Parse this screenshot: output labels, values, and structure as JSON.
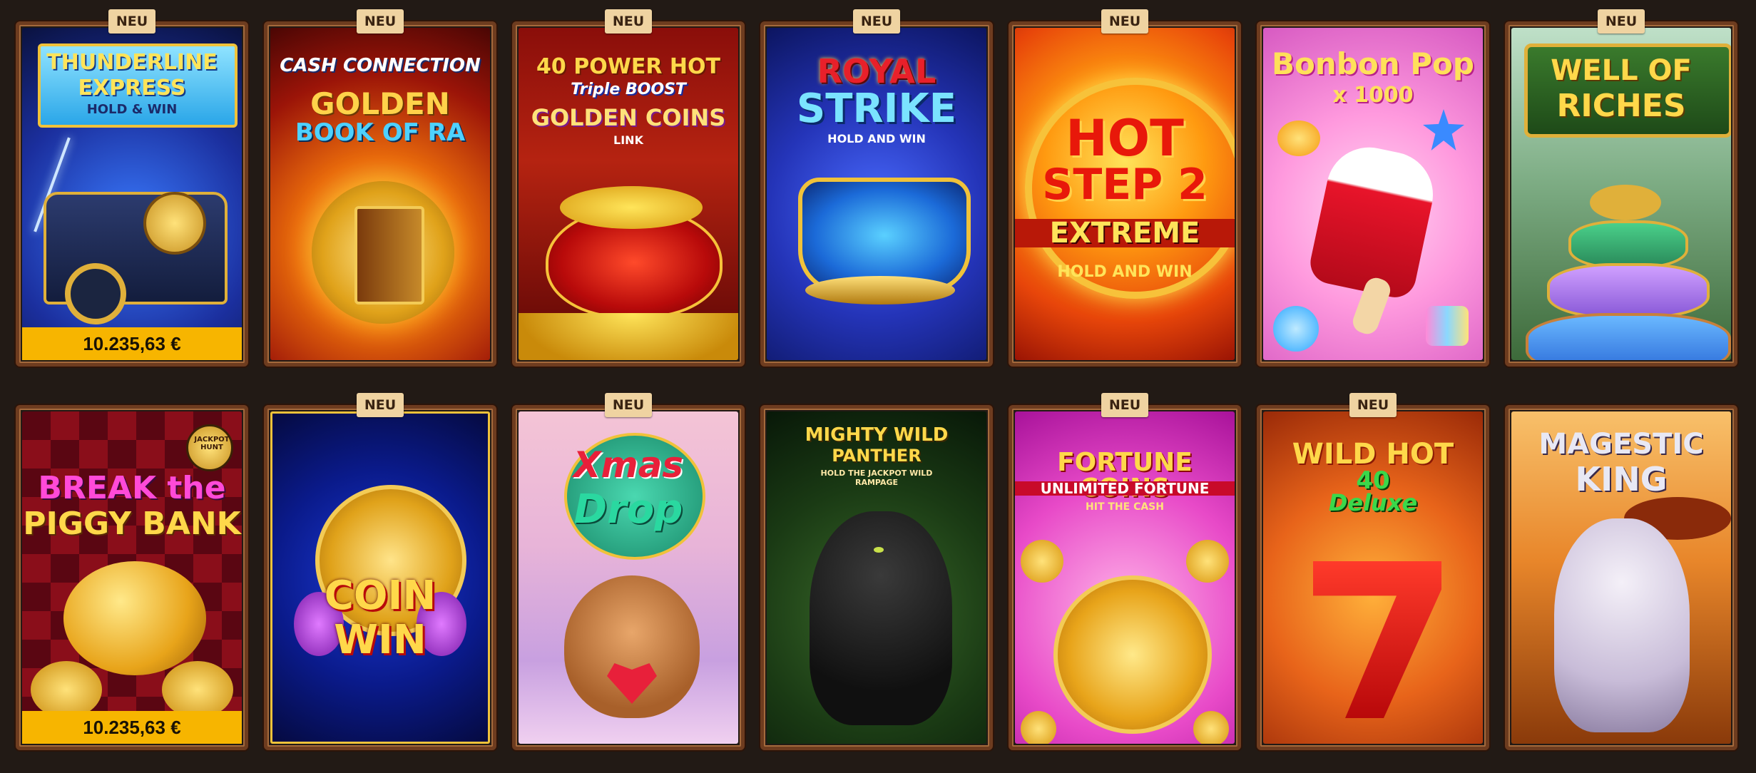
{
  "badge_text": "NEU",
  "games": [
    {
      "title_lines": [
        "THUNDERLINE",
        "EXPRESS"
      ],
      "subtitle": "HOLD & WIN",
      "is_new": true,
      "jackpot": "10.235,63 €"
    },
    {
      "title_lines": [
        "CASH CONNECTION",
        "GOLDEN",
        "BOOK OF RA"
      ],
      "subtitle": "",
      "is_new": true,
      "jackpot": ""
    },
    {
      "title_lines": [
        "40 POWER HOT",
        "Triple BOOST",
        "GOLDEN COINS"
      ],
      "subtitle": "LINK",
      "is_new": true,
      "jackpot": ""
    },
    {
      "title_lines": [
        "ROYAL",
        "STRIKE"
      ],
      "subtitle": "HOLD AND WIN",
      "is_new": true,
      "jackpot": ""
    },
    {
      "title_lines": [
        "HOT",
        "STEP 2",
        "EXTREME"
      ],
      "subtitle": "HOLD AND WIN",
      "is_new": true,
      "jackpot": ""
    },
    {
      "title_lines": [
        "Bonbon Pop",
        "x 1000"
      ],
      "subtitle": "",
      "is_new": false,
      "jackpot": ""
    },
    {
      "title_lines": [
        "WELL OF",
        "RICHES"
      ],
      "subtitle": "",
      "is_new": true,
      "jackpot": ""
    },
    {
      "title_lines": [
        "BREAK the",
        "PIGGY BANK"
      ],
      "subtitle": "JACKPOT HUNT",
      "is_new": false,
      "jackpot": "10.235,63 €"
    },
    {
      "title_lines": [
        "COIN",
        "WIN"
      ],
      "subtitle": "",
      "is_new": true,
      "jackpot": ""
    },
    {
      "title_lines": [
        "Xmas",
        "Drop"
      ],
      "subtitle": "",
      "is_new": true,
      "jackpot": ""
    },
    {
      "title_lines": [
        "MIGHTY WILD",
        "PANTHER"
      ],
      "subtitle": "HOLD THE JACKPOT WILD RAMPAGE",
      "is_new": false,
      "jackpot": ""
    },
    {
      "title_lines": [
        "FORTUNE COINS",
        "UNLIMITED FORTUNE"
      ],
      "subtitle": "HIT THE CASH",
      "is_new": true,
      "jackpot": ""
    },
    {
      "title_lines": [
        "WILD HOT",
        "40",
        "Deluxe"
      ],
      "subtitle": "",
      "is_new": true,
      "jackpot": ""
    },
    {
      "title_lines": [
        "MAGESTIC",
        "KING"
      ],
      "subtitle": "",
      "is_new": false,
      "jackpot": ""
    }
  ],
  "colors": {
    "background": "#221a15",
    "frame": "#6e3c1f",
    "badge": "#efd3a1",
    "jackpot_bar": "#f7b500"
  }
}
